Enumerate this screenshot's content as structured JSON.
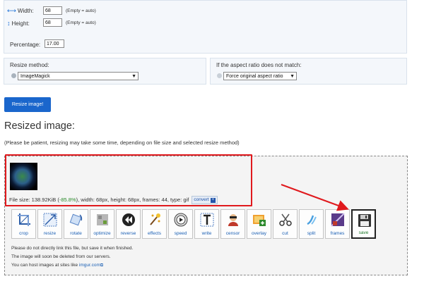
{
  "settings": {
    "width_label": "Width:",
    "width_value": "68",
    "width_hint": "(Empty = auto)",
    "height_label": "Height:",
    "height_value": "68",
    "height_hint": "(Empty = auto)",
    "percentage_label": "Percentage:",
    "percentage_value": "17.00",
    "resize_method_label": "Resize method:",
    "resize_method_value": "ImageMagick",
    "aspect_label": "If the aspect ratio does not match:",
    "aspect_value": "Force original aspect ratio"
  },
  "resize_button_label": "Resize image!",
  "result": {
    "heading": "Resized image:",
    "note": "(Please be patient, resizing may take some time, depending on file size and selected resize method)",
    "file_info_prefix": "File size: 138.92KiB (",
    "file_info_pct": "-85.8%",
    "file_info_suffix": "), width: 68px, height: 68px, frames: 44, type: gif",
    "convert_label": "convert"
  },
  "tools": [
    {
      "label": "crop",
      "icon": "crop-icon"
    },
    {
      "label": "resize",
      "icon": "resize-icon"
    },
    {
      "label": "rotate",
      "icon": "rotate-icon"
    },
    {
      "label": "optimize",
      "icon": "optimize-icon"
    },
    {
      "label": "reverse",
      "icon": "reverse-icon"
    },
    {
      "label": "effects",
      "icon": "effects-icon"
    },
    {
      "label": "speed",
      "icon": "speed-icon"
    },
    {
      "label": "write",
      "icon": "write-icon"
    },
    {
      "label": "censor",
      "icon": "censor-icon"
    },
    {
      "label": "overlay",
      "icon": "overlay-icon"
    },
    {
      "label": "cut",
      "icon": "cut-icon"
    },
    {
      "label": "split",
      "icon": "split-icon"
    },
    {
      "label": "frames",
      "icon": "frames-icon"
    },
    {
      "label": "save",
      "icon": "save-icon"
    }
  ],
  "footer": {
    "line1": "Please do not directly link this file, but save it when finished.",
    "line2": "The image will soon be deleted from our servers.",
    "line3_prefix": "You can host images at sites like ",
    "line3_link": "imgur.com"
  },
  "colors": {
    "accent": "#1a66cc",
    "highlight": "#e0191d",
    "savings": "#2a8a2a"
  }
}
